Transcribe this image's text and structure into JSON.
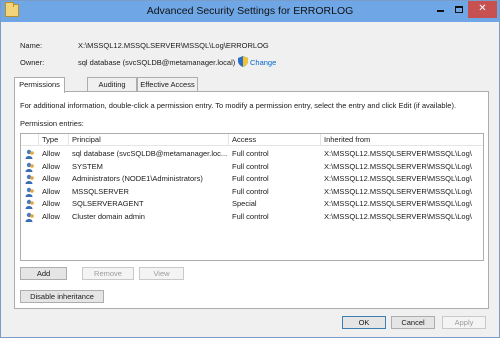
{
  "window": {
    "title": "Advanced Security Settings for ERRORLOG"
  },
  "details": {
    "name_label": "Name:",
    "name_value": "X:\\MSSQL12.MSSQLSERVER\\MSSQL\\Log\\ERRORLOG",
    "owner_label": "Owner:",
    "owner_value": "sql database (svcSQLDB@metamanager.local)",
    "change_link": "Change"
  },
  "tabs": [
    {
      "label": "Permissions",
      "active": true
    },
    {
      "label": "Auditing",
      "active": false
    },
    {
      "label": "Effective Access",
      "active": false
    }
  ],
  "permissions": {
    "info_text": "For additional information, double-click a permission entry. To modify a permission entry, select the entry and click Edit (if available).",
    "entries_label": "Permission entries:",
    "columns": [
      "Type",
      "Principal",
      "Access",
      "Inherited from"
    ],
    "rows": [
      {
        "type": "Allow",
        "principal": "sql database (svcSQLDB@metamanager.loc...",
        "access": "Full control",
        "inherited": "X:\\MSSQL12.MSSQLSERVER\\MSSQL\\Log\\"
      },
      {
        "type": "Allow",
        "principal": "SYSTEM",
        "access": "Full control",
        "inherited": "X:\\MSSQL12.MSSQLSERVER\\MSSQL\\Log\\"
      },
      {
        "type": "Allow",
        "principal": "Administrators (NODE1\\Administrators)",
        "access": "Full control",
        "inherited": "X:\\MSSQL12.MSSQLSERVER\\MSSQL\\Log\\"
      },
      {
        "type": "Allow",
        "principal": "MSSQLSERVER",
        "access": "Full control",
        "inherited": "X:\\MSSQL12.MSSQLSERVER\\MSSQL\\Log\\"
      },
      {
        "type": "Allow",
        "principal": "SQLSERVERAGENT",
        "access": "Special",
        "inherited": "X:\\MSSQL12.MSSQLSERVER\\MSSQL\\Log\\"
      },
      {
        "type": "Allow",
        "principal": "Cluster domain admin",
        "access": "Full control",
        "inherited": "X:\\MSSQL12.MSSQLSERVER\\MSSQL\\Log\\"
      }
    ],
    "add_label": "Add",
    "remove_label": "Remove",
    "view_label": "View",
    "disable_inheritance_label": "Disable inheritance"
  },
  "footer": {
    "ok_label": "OK",
    "cancel_label": "Cancel",
    "apply_label": "Apply"
  },
  "colors": {
    "titlebar": "#6fa7e6",
    "close_button": "#c75050",
    "link": "#0066cc"
  },
  "icons": {
    "title": "folder-icon",
    "owner_change": "shield-icon",
    "principal": "user-group-icon"
  }
}
